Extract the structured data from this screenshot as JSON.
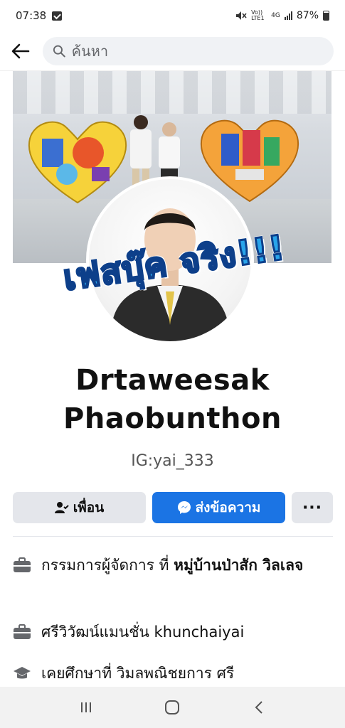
{
  "status_bar": {
    "time": "07:38",
    "network": "Vo)) LTE1",
    "network_type": "4G",
    "battery": "87%",
    "icons": [
      "message-icon",
      "mute-icon",
      "signal-icon",
      "battery-icon"
    ]
  },
  "header": {
    "back_icon": "arrow-left-icon",
    "search_placeholder": "ค้นหา",
    "search_icon": "search-icon"
  },
  "cover": {
    "description_icons": [
      "heart-sculpture-left",
      "heart-sculpture-right",
      "people"
    ]
  },
  "profile": {
    "overlay_text": "เฟสบุ๊ค จริง!!!",
    "name_line1": "Drtaweesak",
    "name_line2": "Phaobunthon",
    "ig_handle": "IG:yai_333"
  },
  "actions": {
    "friends_label": "เพื่อน",
    "message_label": "ส่งข้อความ",
    "more_label": "···"
  },
  "details": [
    {
      "icon": "briefcase-icon",
      "prefix": "กรรมการผู้จัดการ ที่ ",
      "bold": "หมู่บ้านป่าสัก วิลเลจ"
    },
    {
      "icon": "briefcase-icon",
      "prefix": "ศรีวิวัฒน์แมนชั่น khunchaiyai",
      "bold": ""
    },
    {
      "icon": "graduation-cap-icon",
      "prefix": "เคยศึกษาที่ วิมลพณิชยการ ศรี",
      "bold": ""
    }
  ],
  "nav_bar": {
    "icons": [
      "recent-apps-icon",
      "home-icon",
      "back-icon"
    ]
  },
  "colors": {
    "primary": "#1b74e4",
    "secondary_button": "#e4e6eb",
    "overlay_fill": "#29a4ea",
    "overlay_stroke": "#0d3f8a"
  }
}
